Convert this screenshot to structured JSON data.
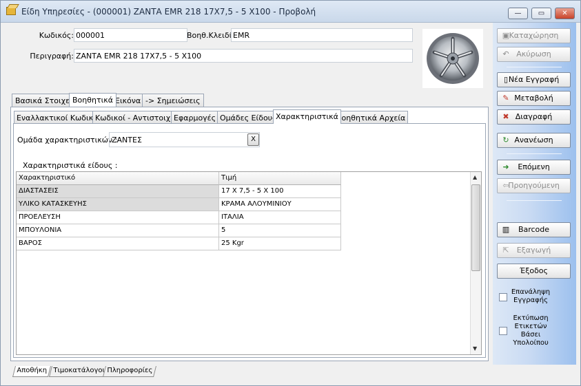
{
  "window": {
    "title": "Είδη Υπηρεσίες - (000001) ΖΑΝΤΑ EMR 218 17X7,5 - 5 X100  -  Προβολή",
    "minimize": "—",
    "maximize": "▭",
    "close": "✕"
  },
  "form": {
    "code_label": "Κωδικός:",
    "code_value": "000001",
    "aux_key_label": "Βοηθ.Κλειδί:",
    "aux_key_value": "EMR",
    "description_label": "Περιγραφή:",
    "description_value": "ΖΑΝΤΑ EMR 218 17X7,5 - 5 X100"
  },
  "main_tabs": [
    {
      "label": "Βασικά Στοιχεία"
    },
    {
      "label": "Βοηθητικά"
    },
    {
      "label": "Εικόνα"
    },
    {
      "label": "-> Σημειώσεις"
    }
  ],
  "sub_tabs": [
    {
      "label": "Εναλλακτικοί Κωδικοί"
    },
    {
      "label": "Κωδικοί - Αντιστοιχίες"
    },
    {
      "label": "Εφαρμογές"
    },
    {
      "label": "Ομάδες Είδους"
    },
    {
      "label": "Χαρακτηριστικά"
    },
    {
      "label": "Βοηθητικά Αρχεία"
    }
  ],
  "characteristics": {
    "group_label": "Ομάδα χαρακτηριστικών :",
    "group_value": "ΖΑΝΤΕΣ",
    "clear_button": "X",
    "list_label": "Χαρακτηριστικά είδους :",
    "columns": [
      "Χαρακτηριστικό",
      "Τιμή"
    ],
    "rows": [
      {
        "name": "ΔΙΑΣΤΑΣΕΙΣ",
        "value": "17 X 7,5 - 5 X 100"
      },
      {
        "name": "ΥΛΙΚΟ ΚΑΤΑΣΚΕΥΗΣ",
        "value": "ΚΡΑΜΑ ΑΛΟΥΜΙΝΙΟΥ"
      },
      {
        "name": "ΠΡΟΕΛΕΥΣΗ",
        "value": "ΙΤΑΛΙΑ"
      },
      {
        "name": "ΜΠΟΥΛΟΝΙΑ",
        "value": "5"
      },
      {
        "name": "ΒΑΡΟΣ",
        "value": "25 Kgr"
      }
    ]
  },
  "actions": {
    "save": "Καταχώρηση",
    "cancel": "Ακύρωση",
    "new_record": "Νέα Εγγραφή",
    "edit": "Μεταβολή",
    "delete": "Διαγραφή",
    "refresh": "Ανανέωση",
    "next": "Επόμενη",
    "previous": "Προηγούμενη",
    "barcode": "Barcode",
    "export": "Εξαγωγή",
    "exit": "Έξοδος",
    "repeat_record": "Επανάληψη Εγγραφής",
    "print_labels": "Εκτύπωση Ετικετών Βάσει Υπολοίπου"
  },
  "bottom_tabs": [
    {
      "label": "Αποθήκη"
    },
    {
      "label": "Τιμοκατάλογοι"
    },
    {
      "label": "Πληροφορίες"
    }
  ],
  "icons": {
    "title": "box-icon",
    "image": "wheel-rim-image"
  }
}
